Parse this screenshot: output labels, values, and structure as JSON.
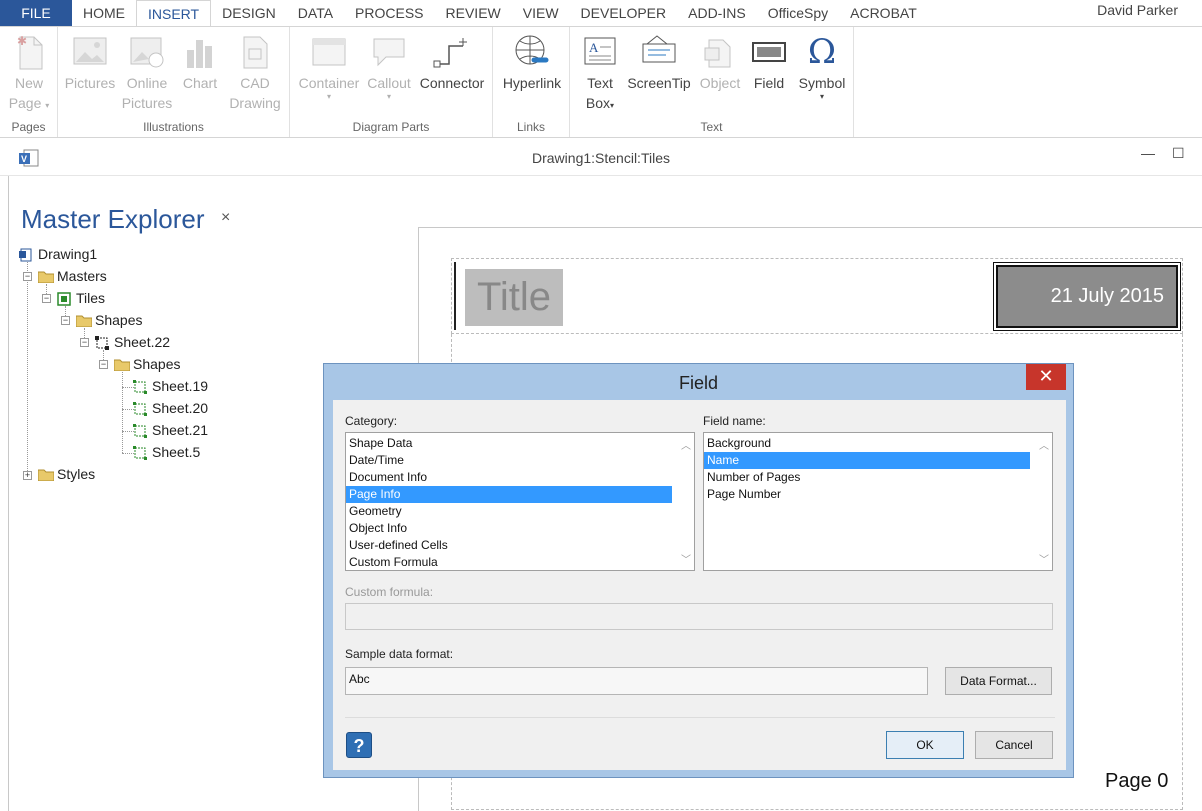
{
  "ribbon": {
    "tabs": [
      "FILE",
      "HOME",
      "INSERT",
      "DESIGN",
      "DATA",
      "PROCESS",
      "REVIEW",
      "VIEW",
      "DEVELOPER",
      "ADD-INS",
      "OfficeSpy",
      "ACROBAT"
    ],
    "active_tab": "INSERT",
    "user": "David Parker",
    "groups": {
      "pages": {
        "label": "Pages",
        "new_page": [
          "New",
          "Page"
        ]
      },
      "illustrations": {
        "label": "Illustrations",
        "pictures": "Pictures",
        "online_pictures": [
          "Online",
          "Pictures"
        ],
        "chart": "Chart",
        "cad_drawing": [
          "CAD",
          "Drawing"
        ]
      },
      "diagram_parts": {
        "label": "Diagram Parts",
        "container": "Container",
        "callout": "Callout",
        "connector": "Connector"
      },
      "links": {
        "label": "Links",
        "hyperlink": "Hyperlink"
      },
      "text": {
        "label": "Text",
        "text_box": [
          "Text",
          "Box"
        ],
        "screentip": "ScreenTip",
        "object": "Object",
        "field": "Field",
        "symbol": "Symbol"
      }
    }
  },
  "document": {
    "title": "Drawing1:Stencil:Tiles",
    "minimize": "—",
    "maximize": "☐"
  },
  "master_explorer": {
    "title": "Master Explorer",
    "close": "×",
    "tree": {
      "drawing": "Drawing1",
      "masters": "Masters",
      "tiles": "Tiles",
      "shapes1": "Shapes",
      "sheet22": "Sheet.22",
      "shapes2": "Shapes",
      "sheet19": "Sheet.19",
      "sheet20": "Sheet.20",
      "sheet21": "Sheet.21",
      "sheet5": "Sheet.5",
      "styles": "Styles"
    }
  },
  "canvas": {
    "title_shape": "Title",
    "date_shape": "21 July 2015",
    "page_number": "Page 0"
  },
  "dialog": {
    "title": "Field",
    "close": "✕",
    "category_label": "Category:",
    "categories": [
      "Shape Data",
      "Date/Time",
      "Document Info",
      "Page Info",
      "Geometry",
      "Object Info",
      "User-defined Cells",
      "Custom Formula"
    ],
    "selected_category": "Page Info",
    "field_name_label": "Field name:",
    "field_names": [
      "Background",
      "Name",
      "Number of Pages",
      "Page Number"
    ],
    "selected_field": "Name",
    "custom_formula_label": "Custom formula:",
    "custom_formula_value": "",
    "sample_label": "Sample data format:",
    "sample_value": "Abc",
    "data_format_button": "Data Format...",
    "ok_button": "OK",
    "cancel_button": "Cancel",
    "help": "?"
  },
  "colors": {
    "accent": "#2b579a",
    "selection": "#3399ff",
    "dialog_frame": "#a8c6e6",
    "close_red": "#c7352b"
  }
}
